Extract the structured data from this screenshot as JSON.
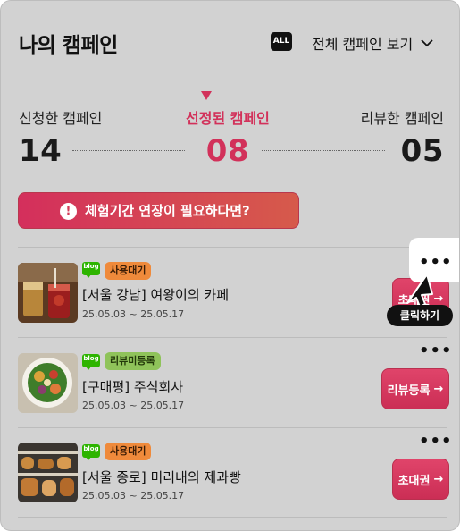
{
  "header": {
    "title": "나의 캠페인",
    "all_badge": "ALL",
    "view_all_label": "전체 캠페인 보기"
  },
  "stats": [
    {
      "label": "신청한 캠페인",
      "value": "14",
      "selected": false
    },
    {
      "label": "선정된 캠페인",
      "value": "08",
      "selected": true
    },
    {
      "label": "리뷰한 캠페인",
      "value": "05",
      "selected": false
    }
  ],
  "alert": {
    "icon": "exclamation-icon",
    "icon_glyph": "!",
    "text": "체험기간 연장이 필요하다면?"
  },
  "campaigns": [
    {
      "blog_label": "blog",
      "status": "사용대기",
      "status_color": "#ef8a3b",
      "name": "[서울 강남] 여왕이의 카페",
      "date": "25.05.03 ~ 25.05.17",
      "action": "초대권",
      "action_arrow": "→",
      "more": "•••"
    },
    {
      "blog_label": "blog",
      "status": "리뷰미등록",
      "status_color": "#8fc35a",
      "name": "[구매평]  주식회사",
      "date": "25.05.03 ~ 25.05.17",
      "action": "리뷰등록",
      "action_arrow": "→",
      "more": "•••"
    },
    {
      "blog_label": "blog",
      "status": "사용대기",
      "status_color": "#ef8a3b",
      "name": "[서울 종로] 미리내의 제과빵",
      "date": "25.05.03 ~ 25.05.17",
      "action": "초대권",
      "action_arrow": "→",
      "more": "•••"
    }
  ],
  "overlay": {
    "click_tooltip": "클릭하기",
    "highlight_dots": "•••"
  },
  "colors": {
    "accent": "#d2315a",
    "background_dim": "#d2d2d2",
    "blog_green": "#2db400"
  }
}
